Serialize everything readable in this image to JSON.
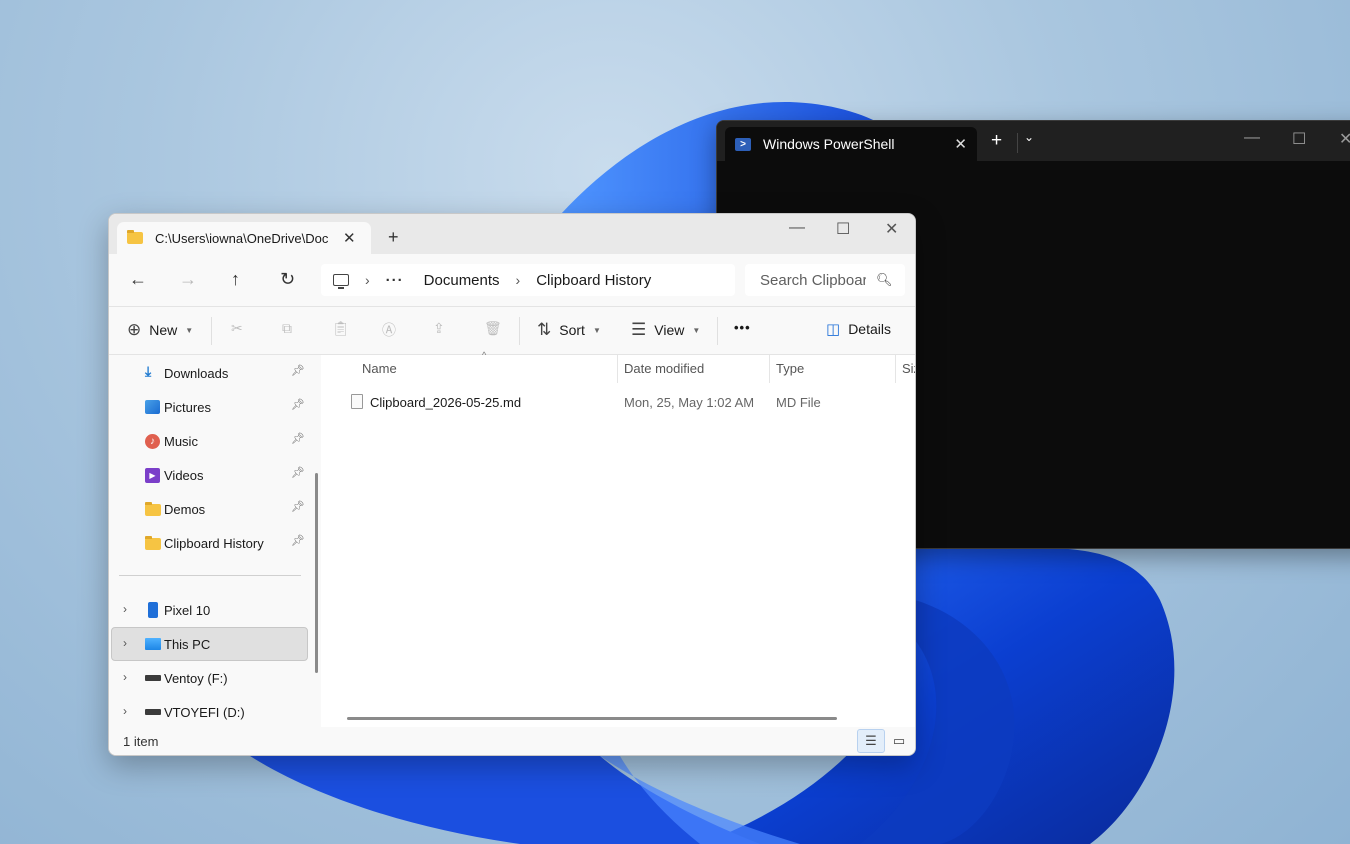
{
  "terminal": {
    "tab_title": "Windows PowerShell",
    "tab_close": "✕",
    "new_tab": "+",
    "dropdown": "⌄",
    "minimize": "—",
    "maximize": "☐",
    "close": "✕"
  },
  "explorer": {
    "tab_title": "C:\\Users\\iowna\\OneDrive\\Documents\\Clipboard History",
    "tab_close": "✕",
    "new_tab": "+",
    "window_controls": {
      "minimize": "—",
      "maximize": "☐",
      "close": "✕"
    },
    "nav": {
      "back": "←",
      "forward": "→",
      "up": "↑",
      "refresh": "↻"
    },
    "address": {
      "ellipsis": "···",
      "crumbs": [
        "Documents",
        "Clipboard History"
      ],
      "separator": "›"
    },
    "search": {
      "placeholder": "Search Clipboard History"
    },
    "toolbar": {
      "new_label": "New",
      "sort_label": "Sort",
      "view_label": "View",
      "more_label": "•••",
      "details_label": "Details"
    },
    "sidebar": {
      "quick_access": [
        {
          "label": "Downloads",
          "icon": "download-icon"
        },
        {
          "label": "Pictures",
          "icon": "pictures-icon"
        },
        {
          "label": "Music",
          "icon": "music-icon"
        },
        {
          "label": "Videos",
          "icon": "videos-icon"
        },
        {
          "label": "Demos",
          "icon": "folder-icon"
        },
        {
          "label": "Clipboard History",
          "icon": "folder-icon"
        }
      ],
      "devices": [
        {
          "label": "Pixel 10",
          "icon": "phone-icon"
        },
        {
          "label": "This PC",
          "icon": "this-pc-icon",
          "selected": true
        },
        {
          "label": "Ventoy (F:)",
          "icon": "drive-icon"
        },
        {
          "label": "VTOYEFI (D:)",
          "icon": "drive-icon"
        }
      ]
    },
    "columns": [
      "Name",
      "Date modified",
      "Type",
      "Size"
    ],
    "files": [
      {
        "name": "Clipboard_2026-05-25.md",
        "date_modified": "Mon, 25, May 1:02 AM",
        "type": "MD File"
      }
    ],
    "status": {
      "item_count": "1 item"
    }
  },
  "colors": {
    "accent": "#1f6fd8",
    "folder": "#f6c443",
    "terminal_bg": "#0c0c0c"
  }
}
